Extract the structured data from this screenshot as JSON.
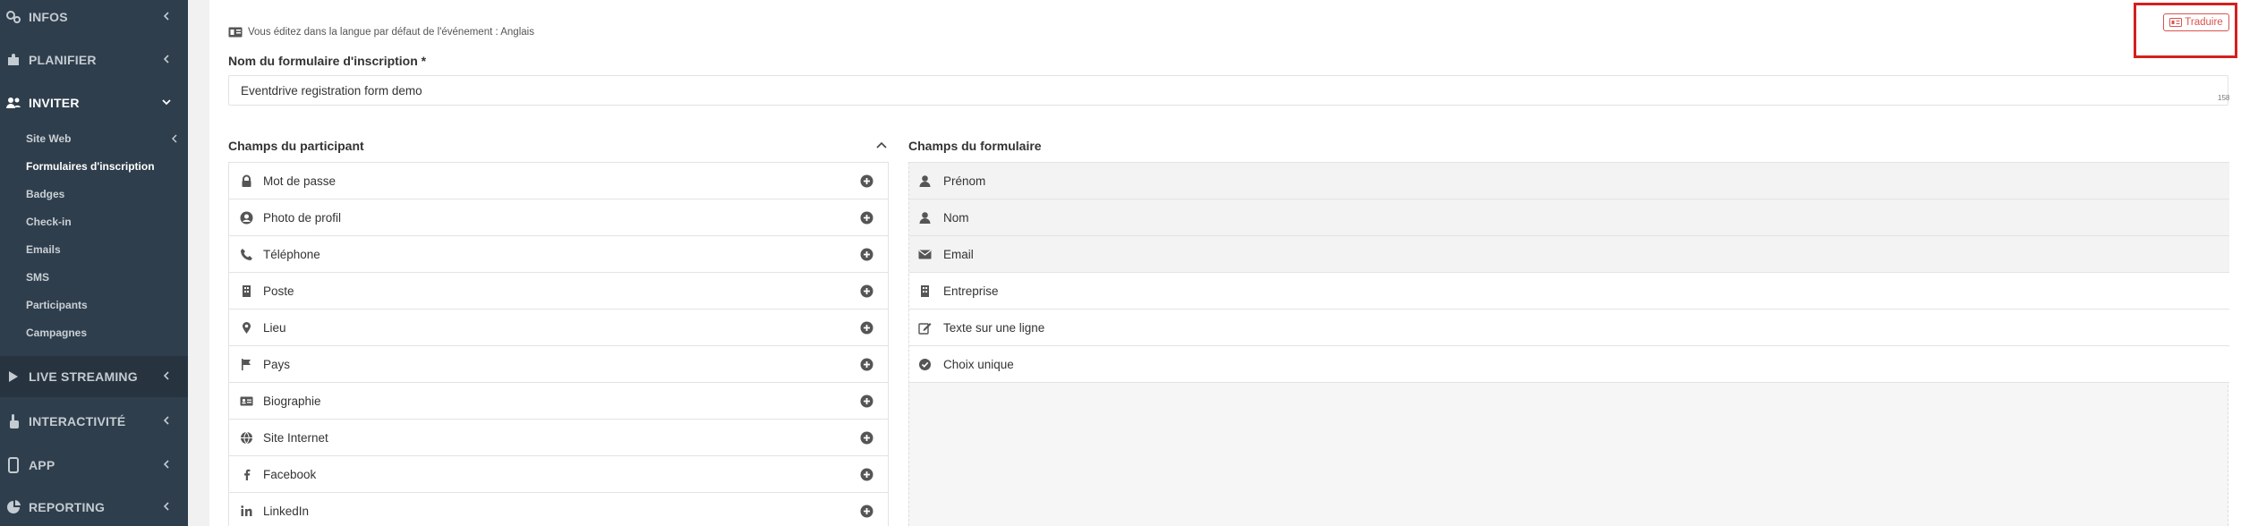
{
  "sidebar": {
    "main_items": [
      {
        "label": "INFOS",
        "icon": "cogs-icon"
      },
      {
        "label": "PLANIFIER",
        "icon": "puzzle-icon"
      },
      {
        "label": "INVITER",
        "icon": "users-icon"
      },
      {
        "label": "LIVE STREAMING",
        "icon": "play-icon"
      },
      {
        "label": "INTERACTIVITÉ",
        "icon": "hand-pointer-icon"
      },
      {
        "label": "APP",
        "icon": "mobile-icon"
      },
      {
        "label": "REPORTING",
        "icon": "pie-chart-icon"
      }
    ],
    "sub_items": [
      {
        "label": "Site Web"
      },
      {
        "label": "Formulaires d'inscription"
      },
      {
        "label": "Badges"
      },
      {
        "label": "Check-in"
      },
      {
        "label": "Emails"
      },
      {
        "label": "SMS"
      },
      {
        "label": "Participants"
      },
      {
        "label": "Campagnes"
      }
    ]
  },
  "main": {
    "info_text": "Vous éditez dans la langue par défaut de l'événement : Anglais",
    "translate_label": "Traduire",
    "form_name_label": "Nom du formulaire d'inscription *",
    "form_name_value": "Eventdrive registration form demo",
    "form_name_count": "158",
    "participant_fields_title": "Champs du participant",
    "form_fields_title": "Champs du formulaire",
    "participant_fields": [
      {
        "label": "Mot de passe",
        "icon": "lock-icon"
      },
      {
        "label": "Photo de profil",
        "icon": "user-circle-icon"
      },
      {
        "label": "Téléphone",
        "icon": "phone-icon"
      },
      {
        "label": "Poste",
        "icon": "building-icon"
      },
      {
        "label": "Lieu",
        "icon": "map-marker-icon"
      },
      {
        "label": "Pays",
        "icon": "flag-icon"
      },
      {
        "label": "Biographie",
        "icon": "id-card-icon"
      },
      {
        "label": "Site Internet",
        "icon": "globe-icon"
      },
      {
        "label": "Facebook",
        "icon": "facebook-icon"
      },
      {
        "label": "LinkedIn",
        "icon": "linkedin-icon"
      }
    ],
    "form_fields": [
      {
        "label": "Prénom",
        "icon": "user-icon"
      },
      {
        "label": "Nom",
        "icon": "user-icon"
      },
      {
        "label": "Email",
        "icon": "envelope-icon"
      },
      {
        "label": "Entreprise",
        "icon": "building-icon"
      },
      {
        "label": "Texte sur une ligne",
        "icon": "edit-icon"
      },
      {
        "label": "Choix unique",
        "icon": "check-circle-icon"
      }
    ]
  },
  "colors": {
    "sidebar_bg": "#2f3e4c",
    "sidebar_dark_bg": "#27343f",
    "accent_red": "#d9534f",
    "highlight_red": "#d42020"
  }
}
